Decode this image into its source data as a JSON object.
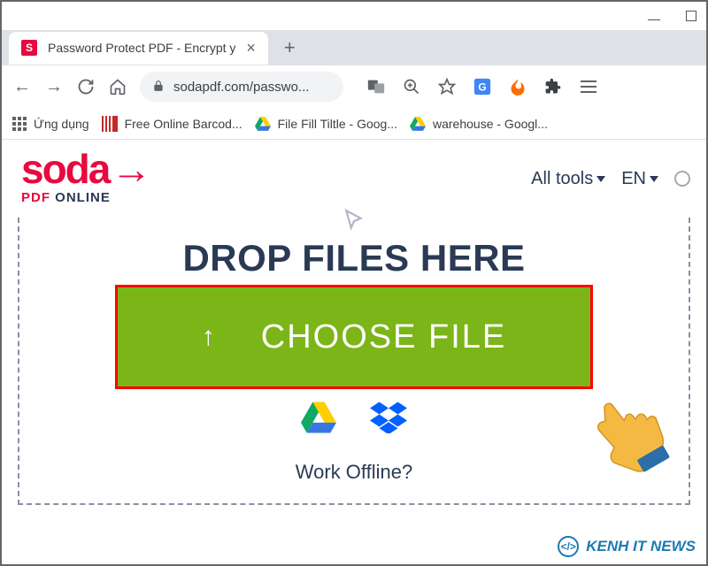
{
  "window": {
    "tab_title": "Password Protect PDF - Encrypt y",
    "tab_favicon_letter": "S",
    "url": "sodapdf.com/passwo..."
  },
  "bookmarks": {
    "apps": "Ứng dụng",
    "items": [
      {
        "label": "Free Online Barcod..."
      },
      {
        "label": "File Fill Tiltle - Goog..."
      },
      {
        "label": "warehouse - Googl..."
      }
    ]
  },
  "site": {
    "logo_main": "soda",
    "logo_sub_red": "PDF",
    "logo_sub_dark": " ONLINE",
    "menu": {
      "all_tools": "All tools",
      "lang": "EN"
    },
    "drop": {
      "title": "DROP FILES HERE",
      "choose": "CHOOSE FILE",
      "offline": "Work Offline?"
    }
  },
  "watermark": {
    "text": "KENH IT NEWS",
    "icon": "</>"
  }
}
